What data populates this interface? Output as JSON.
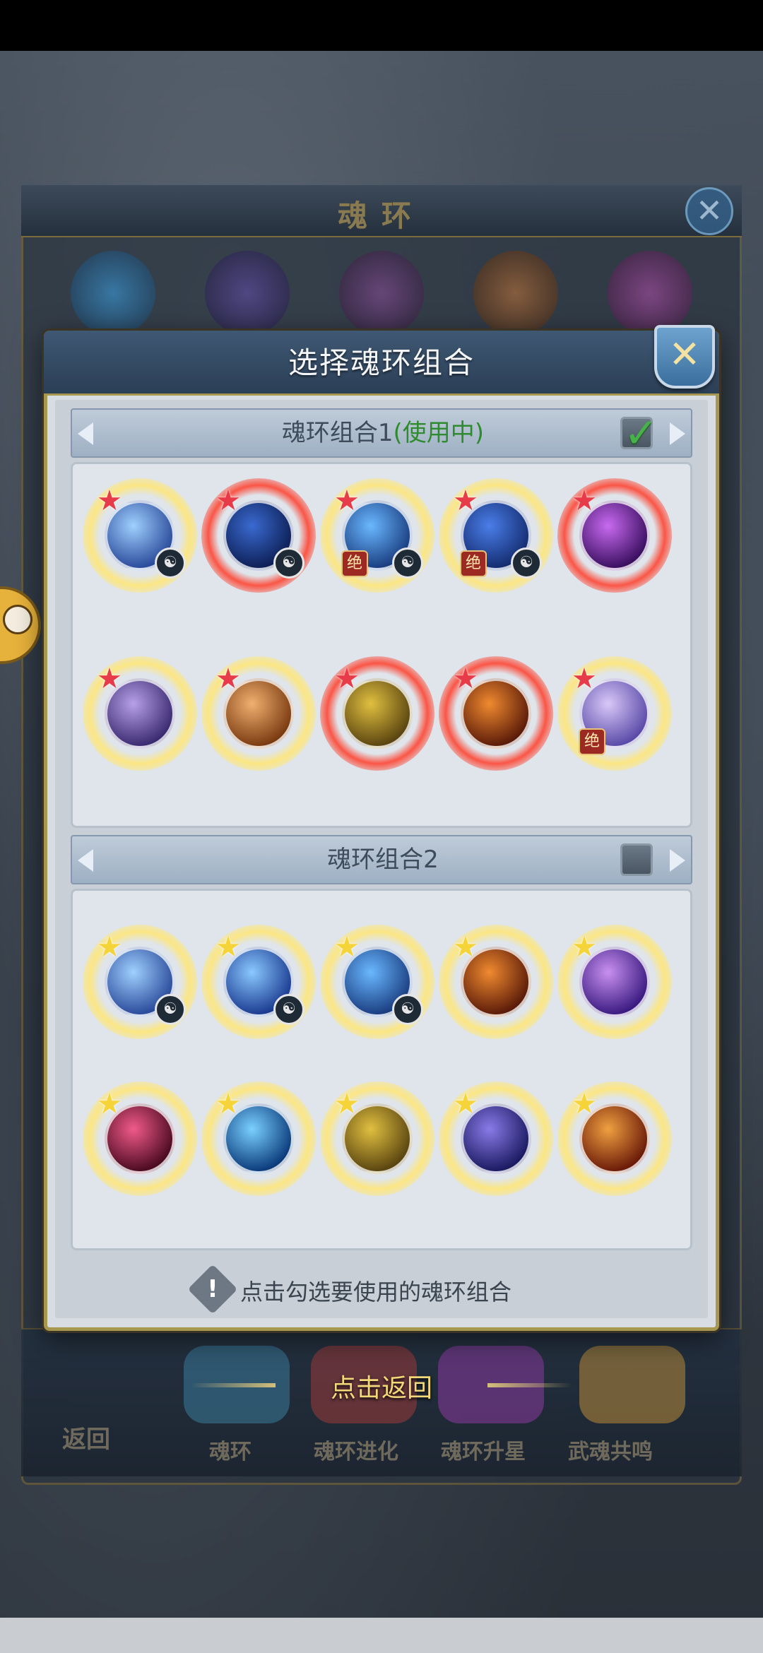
{
  "background_window": {
    "title": "魂环",
    "close_icon": "close-icon",
    "nav": [
      "返回",
      "魂环",
      "魂环进化",
      "魂环升星",
      "武魂共鸣"
    ]
  },
  "dialog": {
    "title": "选择魂环组合",
    "close_icon": "close-icon",
    "groups": [
      {
        "name": "魂环组合1",
        "status": "(使用中)",
        "checked": true,
        "rings": [
          {
            "icon": "ice-dragon-ring",
            "star": "red",
            "badge_skill": true,
            "badge_jue": false
          },
          {
            "icon": "blue-dragon-ring",
            "star": "red",
            "badge_skill": true,
            "badge_jue": false
          },
          {
            "icon": "water-dragon-ring",
            "star": "red",
            "badge_skill": true,
            "badge_jue": true
          },
          {
            "icon": "sea-dragon-ring",
            "star": "red",
            "badge_skill": true,
            "badge_jue": true
          },
          {
            "icon": "purple-energy-ring",
            "star": "red",
            "badge_skill": false,
            "badge_jue": false
          },
          {
            "icon": "purple-dragon-ring",
            "star": "red",
            "badge_skill": false,
            "badge_jue": false
          },
          {
            "icon": "orange-dragon-ring",
            "star": "red",
            "badge_skill": false,
            "badge_jue": false
          },
          {
            "icon": "golden-fist-ring",
            "star": "red",
            "badge_skill": false,
            "badge_jue": false
          },
          {
            "icon": "fire-demon-ring",
            "star": "red",
            "badge_skill": false,
            "badge_jue": false
          },
          {
            "icon": "lightning-ring",
            "star": "red",
            "badge_skill": false,
            "badge_jue": true
          }
        ],
        "jue_label": "绝"
      },
      {
        "name": "魂环组合2",
        "status": "",
        "checked": false,
        "rings": [
          {
            "icon": "ice-dragon-ring",
            "star": "gold",
            "badge_skill": true
          },
          {
            "icon": "blue-lightning-ring",
            "star": "gold",
            "badge_skill": true
          },
          {
            "icon": "water-dragon-ring",
            "star": "gold",
            "badge_skill": true
          },
          {
            "icon": "fire-demon-ring",
            "star": "gold",
            "badge_skill": false
          },
          {
            "icon": "purple-lightning-ring",
            "star": "gold",
            "badge_skill": false
          },
          {
            "icon": "pink-slash-ring",
            "star": "gold",
            "badge_skill": false
          },
          {
            "icon": "blue-vortex-ring",
            "star": "gold",
            "badge_skill": false
          },
          {
            "icon": "golden-fist-ring",
            "star": "gold",
            "badge_skill": false
          },
          {
            "icon": "purple-bird-ring",
            "star": "gold",
            "badge_skill": false
          },
          {
            "icon": "fire-fist-ring",
            "star": "gold",
            "badge_skill": false
          }
        ]
      }
    ],
    "hint": "点击勾选要使用的魂环组合"
  },
  "back_hint": "点击返回",
  "colors": {
    "accent_gold": "#a8974f",
    "in_use_green": "#2e8b2e",
    "header_blue": "#3f5873"
  }
}
